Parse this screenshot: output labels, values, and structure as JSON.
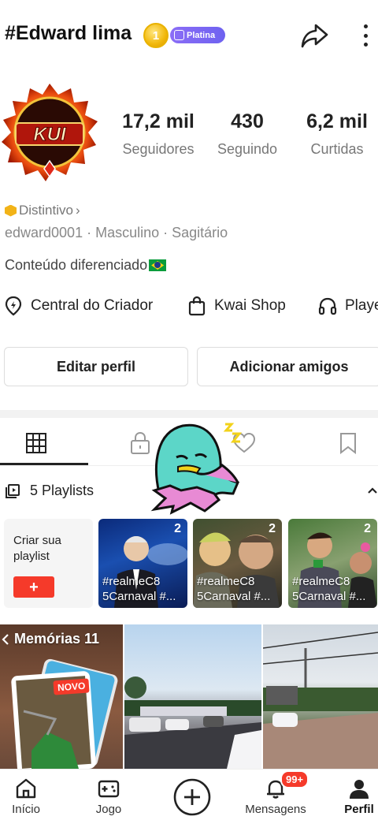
{
  "header": {
    "username": "#Edward lima",
    "coin_badge": "1",
    "tier_label": "Platina"
  },
  "stats": [
    {
      "value": "17,2 mil",
      "label": "Seguidores"
    },
    {
      "value": "430",
      "label": "Seguindo"
    },
    {
      "value": "6,2 mil",
      "label": "Curtidas"
    }
  ],
  "avatar_text": "KUI",
  "profile": {
    "badge_label": "Distintivo",
    "badge_chevron": "›",
    "meta": "edward0001 · Masculino · Sagitário",
    "bio": "Conteúdo diferenciado"
  },
  "tools": [
    {
      "label": "Central do Criador",
      "icon": "location-pin-icon"
    },
    {
      "label": "Kwai Shop",
      "icon": "shopping-bag-icon"
    },
    {
      "label": "Playe",
      "icon": "headphones-icon"
    }
  ],
  "buttons": {
    "edit": "Editar perfil",
    "add_friends": "Adicionar amigos"
  },
  "playlists": {
    "header": "5 Playlists",
    "create_label": "Criar sua playlist",
    "create_plus": "+",
    "items": [
      {
        "count": "2",
        "caption": "#realmeC8 5Carnaval #..."
      },
      {
        "count": "2",
        "caption": "#realmeC8 5Carnaval #..."
      },
      {
        "count": "2",
        "caption": "#realmeC8 5Carnaval #..."
      }
    ]
  },
  "grid": {
    "memories_label": "Memórias 11",
    "new_badge": "NOVO"
  },
  "nav": {
    "items": [
      "Início",
      "Jogo",
      "Mensagens",
      "Perfil"
    ],
    "badge": "99+"
  },
  "colors": {
    "accent": "#f53a2a",
    "tier": "#7b68f2",
    "coin": "#f2b90c"
  }
}
